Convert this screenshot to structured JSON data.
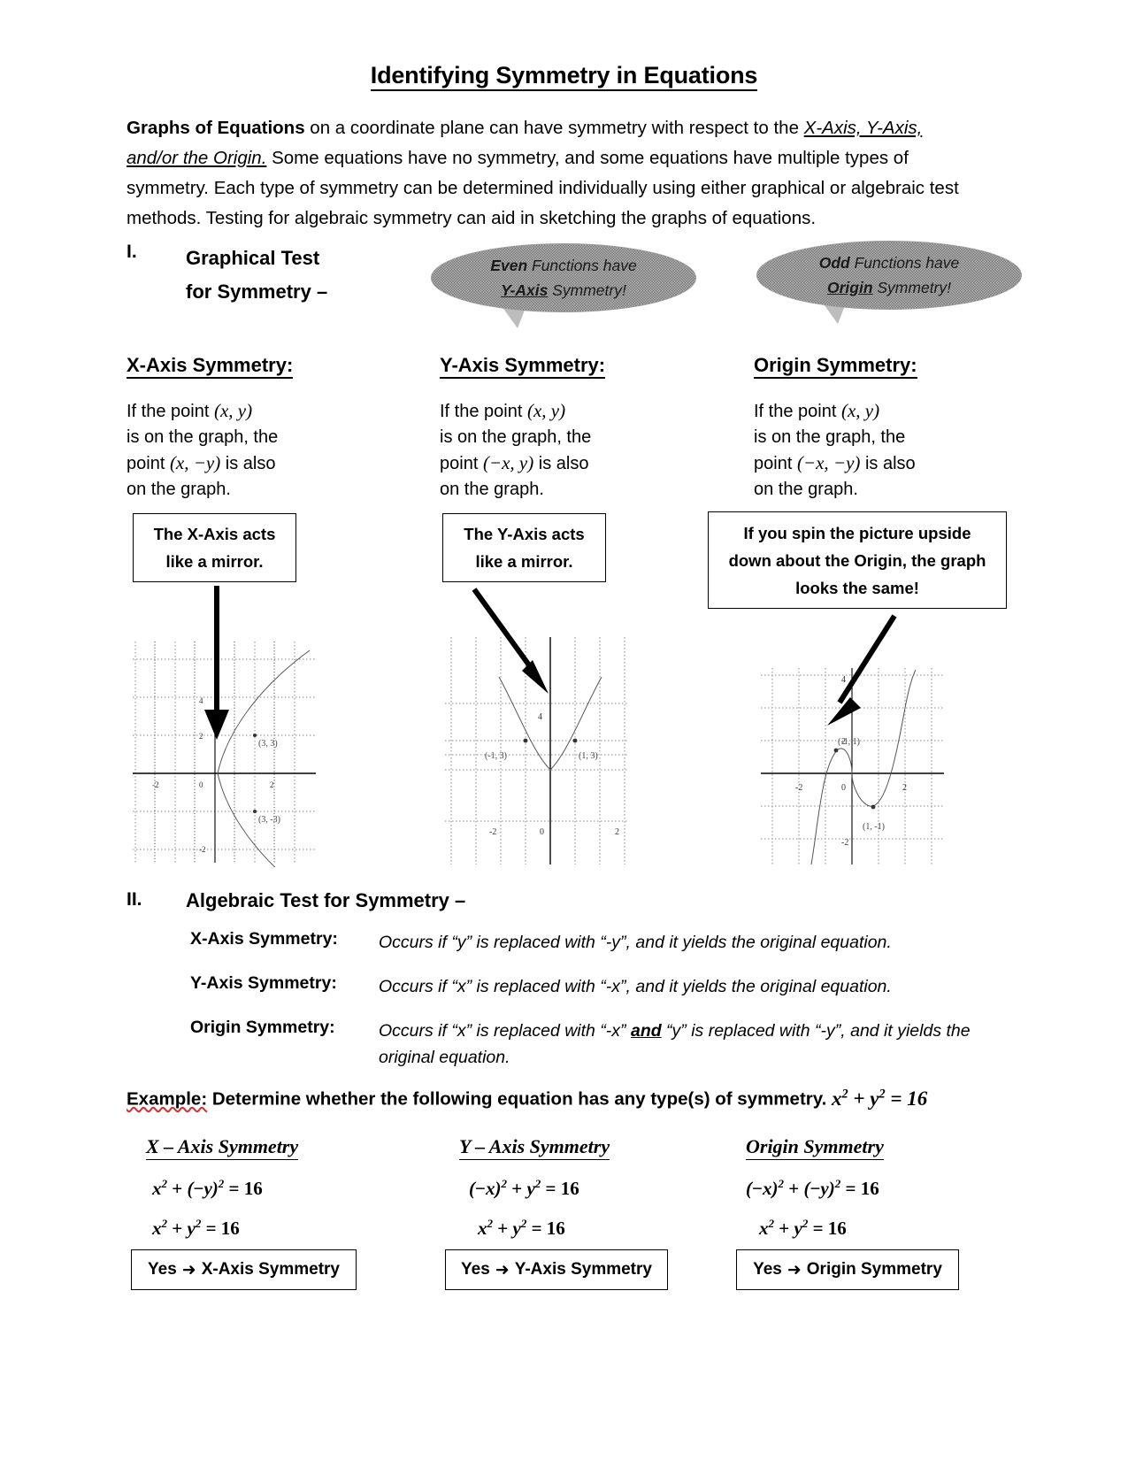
{
  "title": "Identifying Symmetry in Equations",
  "intro": {
    "bold_lead": "Graphs of Equations",
    "part1": " on a coordinate plane can have symmetry with respect to the ",
    "emph1": "X-Axis, Y-Axis, and/or the Origin.",
    "part2": "  Some equations have no symmetry, and some equations have multiple types of symmetry.  Each type of symmetry can be determined individually using either graphical or algebraic test methods.  Testing for algebraic symmetry can aid in sketching the graphs of equations."
  },
  "section_one": {
    "number": "I.",
    "title_line1": "Graphical Test",
    "title_line2": "for Symmetry  –"
  },
  "bubbles": {
    "even": {
      "emph": "Even",
      "rest": " Functions have",
      "line2_u": "Y-Axis",
      "line2_rest": " Symmetry!"
    },
    "odd": {
      "emph": "Odd",
      "rest": " Functions have",
      "line2_u": "Origin",
      "line2_rest": " Symmetry!"
    }
  },
  "columns": [
    {
      "heading": "X-Axis Symmetry:",
      "line1_pre": "If the point ",
      "line1_math": "(x, y)",
      "line2": "is on the graph, the",
      "line3_pre": "point ",
      "line3_math": "(x, −y)",
      "line3_post": " is also",
      "line4": "on the graph.",
      "note_line1": "The X-Axis acts",
      "note_line2": "like a mirror."
    },
    {
      "heading": "Y-Axis Symmetry:",
      "line1_pre": "If the point ",
      "line1_math": "(x, y)",
      "line2": "is on the graph, the",
      "line3_pre": "point ",
      "line3_math": "(−x, y)",
      "line3_post": " is also",
      "line4": "on the graph.",
      "note_line1": "The Y-Axis acts",
      "note_line2": "like a mirror."
    },
    {
      "heading": "Origin Symmetry:",
      "line1_pre": "If the point ",
      "line1_math": "(x, y)",
      "line2": "is on the graph, the",
      "line3_pre": "point ",
      "line3_math": "(−x, −y)",
      "line3_post": " is also",
      "line4": "on the graph.",
      "note_line1": "If you spin the picture upside",
      "note_line2": "down about the Origin, the graph",
      "note_line3": "looks the same!"
    }
  ],
  "chart_data": [
    {
      "type": "line",
      "name": "x-axis-symmetry-graph",
      "title": "",
      "xlabel": "",
      "ylabel": "",
      "xlim": [
        -4,
        4
      ],
      "ylim": [
        -4,
        4
      ],
      "grid": true,
      "xticks": [
        -2,
        0,
        2
      ],
      "yticks": [
        -2,
        2,
        4
      ],
      "curve_description": "sideways parabola opening right, vertex near (-2, 0)",
      "annotations": [
        {
          "label": "(3, 3)",
          "x": 3,
          "y": 3
        },
        {
          "label": "(3, -3)",
          "x": 3,
          "y": -3
        }
      ]
    },
    {
      "type": "line",
      "name": "y-axis-symmetry-graph",
      "title": "",
      "xlabel": "",
      "ylabel": "",
      "xlim": [
        -3,
        3
      ],
      "ylim": [
        -3,
        5
      ],
      "grid": true,
      "xticks": [
        -2,
        0,
        2
      ],
      "yticks": [
        4
      ],
      "curve_description": "upward parabola, vertex near (0, 2)",
      "annotations": [
        {
          "label": "(-1, 3)",
          "x": -1,
          "y": 3
        },
        {
          "label": "(1, 3)",
          "x": 1,
          "y": 3
        }
      ]
    },
    {
      "type": "line",
      "name": "origin-symmetry-graph",
      "title": "",
      "xlabel": "",
      "ylabel": "",
      "xlim": [
        -3,
        3
      ],
      "ylim": [
        -3,
        5
      ],
      "grid": true,
      "xticks": [
        -2,
        0,
        2
      ],
      "yticks": [
        -2,
        2,
        4
      ],
      "curve_description": "odd cubic through the origin with local max near (-1,1) and local min near (1,-1)",
      "annotations": [
        {
          "label": "(-1, 1)",
          "x": -1,
          "y": 1
        },
        {
          "label": "(1, -1)",
          "x": 1,
          "y": -1
        }
      ]
    }
  ],
  "section_two": {
    "number": "II.",
    "title": "Algebraic Test for Symmetry –",
    "rows": [
      {
        "label": "X-Axis Symmetry:",
        "text": "Occurs if “y” is replaced with “-y”, and it yields the original equation."
      },
      {
        "label": "Y-Axis Symmetry:",
        "text": "Occurs if “x” is replaced with “-x”, and it yields the original equation."
      },
      {
        "label": "Origin Symmetry:",
        "text_pre": "Occurs if “x” is replaced with “-x” ",
        "text_u": "and",
        "text_post": " “y” is replaced with “-y”, and it yields the original equation."
      }
    ]
  },
  "example": {
    "label": "Example:",
    "prompt": "  Determine whether the following equation has any type(s) of symmetry.",
    "equation": "x² + y² = 16",
    "columns": [
      {
        "heading": "X – Axis Symmetry",
        "step1": "x² + (−y)² = 16",
        "step2": "x² + y² = 16",
        "answer": "Yes",
        "answer_arrow": "➜",
        "answer_tail": "X-Axis Symmetry"
      },
      {
        "heading": "Y – Axis Symmetry ",
        "step1": "(−x)² + y² = 16",
        "step2": "x² + y² = 16",
        "answer": "Yes",
        "answer_arrow": "➜",
        "answer_tail": "Y-Axis Symmetry"
      },
      {
        "heading": "Origin Symmetry",
        "step1": "(−x)² + (−y)² = 16",
        "step2": "x² + y² = 16",
        "answer": "Yes",
        "answer_arrow": "➜",
        "answer_tail": "Origin Symmetry"
      }
    ]
  },
  "colors": {
    "ink": "#000000",
    "paper": "#ffffff",
    "bubble_fill": "#d6d6d6",
    "grid": "#8a8a8a",
    "spellcheck": "#d83030"
  }
}
